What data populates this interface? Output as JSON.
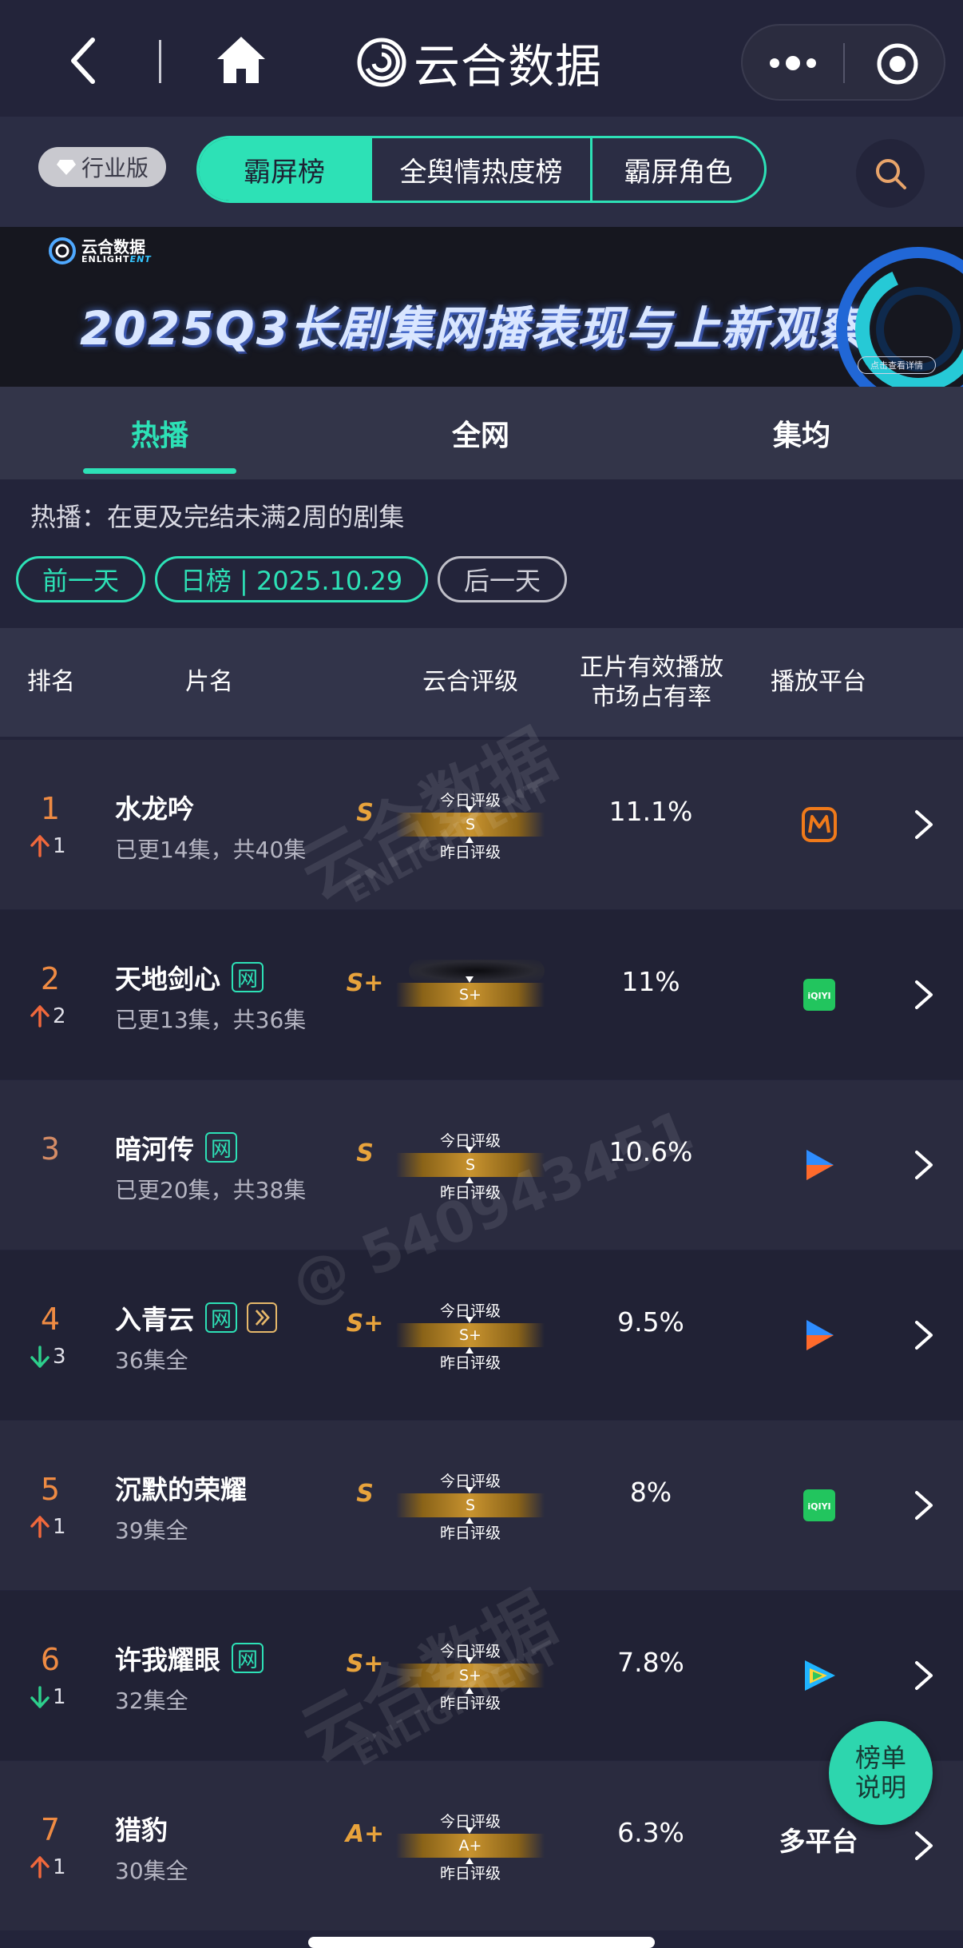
{
  "header": {
    "title": "云合数据"
  },
  "toolbar": {
    "industry_label": "行业版",
    "segments": [
      "霸屏榜",
      "全舆情热度榜",
      "霸屏角色"
    ],
    "active_segment": 0
  },
  "banner": {
    "logo_cn": "云合数据",
    "logo_en_a": "ENLIGHT",
    "logo_en_b": "ENT",
    "title": "2025Q3长剧集网播表现与上新观察",
    "cta": "点击查看详情"
  },
  "category_tabs": [
    "热播",
    "全网",
    "集均"
  ],
  "info": {
    "text": "热播：在更及完结未满2周的剧集",
    "prev_day": "前一天",
    "current": "日榜 | 2025.10.29",
    "next_day": "后一天"
  },
  "table_header": {
    "rank": "排名",
    "name": "片名",
    "grade": "云合评级",
    "share_line1": "正片有效播放",
    "share_line2": "市场占有率",
    "platform": "播放平台"
  },
  "grade_labels": {
    "today": "今日评级",
    "yesterday": "昨日评级"
  },
  "rows": [
    {
      "rank": "1",
      "change_dir": "up",
      "change": "1",
      "title": "水龙吟",
      "tags": [],
      "subtitle": "已更14集，共40集",
      "grade": "S",
      "grade_bar": "S",
      "share": "11.1%",
      "platform": "mango",
      "platform_text": ""
    },
    {
      "rank": "2",
      "change_dir": "up",
      "change": "2",
      "title": "天地剑心",
      "tags": [
        "网"
      ],
      "subtitle": "已更13集，共36集",
      "grade": "S+",
      "grade_bar": "S+",
      "share": "11%",
      "platform": "iqiyi",
      "platform_text": "",
      "blurred": true
    },
    {
      "rank": "3",
      "change_dir": "",
      "change": "",
      "title": "暗河传",
      "tags": [
        "网"
      ],
      "subtitle": "已更20集，共38集",
      "grade": "S",
      "grade_bar": "S",
      "share": "10.6%",
      "platform": "youku",
      "platform_text": ""
    },
    {
      "rank": "4",
      "change_dir": "down",
      "change": "3",
      "title": "入青云",
      "tags": [
        "网",
        "ff"
      ],
      "subtitle": "36集全",
      "grade": "S+",
      "grade_bar": "S+",
      "share": "9.5%",
      "platform": "youku",
      "platform_text": ""
    },
    {
      "rank": "5",
      "change_dir": "up",
      "change": "1",
      "title": "沉默的荣耀",
      "tags": [],
      "subtitle": "39集全",
      "grade": "S",
      "grade_bar": "S",
      "share": "8%",
      "platform": "iqiyi",
      "platform_text": ""
    },
    {
      "rank": "6",
      "change_dir": "down",
      "change": "1",
      "title": "许我耀眼",
      "tags": [
        "网"
      ],
      "subtitle": "32集全",
      "grade": "S+",
      "grade_bar": "S+",
      "share": "7.8%",
      "platform": "tencent",
      "platform_text": ""
    },
    {
      "rank": "7",
      "change_dir": "up",
      "change": "1",
      "title": "猎豹",
      "tags": [],
      "subtitle": "30集全",
      "grade": "A+",
      "grade_bar": "A+",
      "share": "6.3%",
      "platform": "multi",
      "platform_text": "多平台"
    }
  ],
  "watermark": {
    "brand_cn": "云合数据",
    "brand_en": "ENLIGHTENT",
    "user_id": "@ 540943451"
  },
  "fab_label_line1": "榜单",
  "fab_label_line2": "说明",
  "colors": {
    "accent": "#2de1b6",
    "rank": "#ef8b43",
    "up": "#f0683c",
    "down": "#2dcf8c",
    "grade": "#e8a33c"
  },
  "chart_data": {
    "type": "table",
    "columns": [
      "排名",
      "片名",
      "云合评级",
      "正片有效播放市场占有率",
      "播放平台"
    ],
    "rows": [
      [
        "1",
        "水龙吟",
        "S",
        "11.1%",
        "芒果TV"
      ],
      [
        "2",
        "天地剑心",
        "S+",
        "11%",
        "爱奇艺"
      ],
      [
        "3",
        "暗河传",
        "S",
        "10.6%",
        "优酷"
      ],
      [
        "4",
        "入青云",
        "S+",
        "9.5%",
        "优酷"
      ],
      [
        "5",
        "沉默的荣耀",
        "S",
        "8%",
        "爱奇艺"
      ],
      [
        "6",
        "许我耀眼",
        "S+",
        "7.8%",
        "腾讯视频"
      ],
      [
        "7",
        "猎豹",
        "A+",
        "6.3%",
        "多平台"
      ]
    ],
    "values": [
      11.1,
      11,
      10.6,
      9.5,
      8,
      7.8,
      6.3
    ]
  }
}
